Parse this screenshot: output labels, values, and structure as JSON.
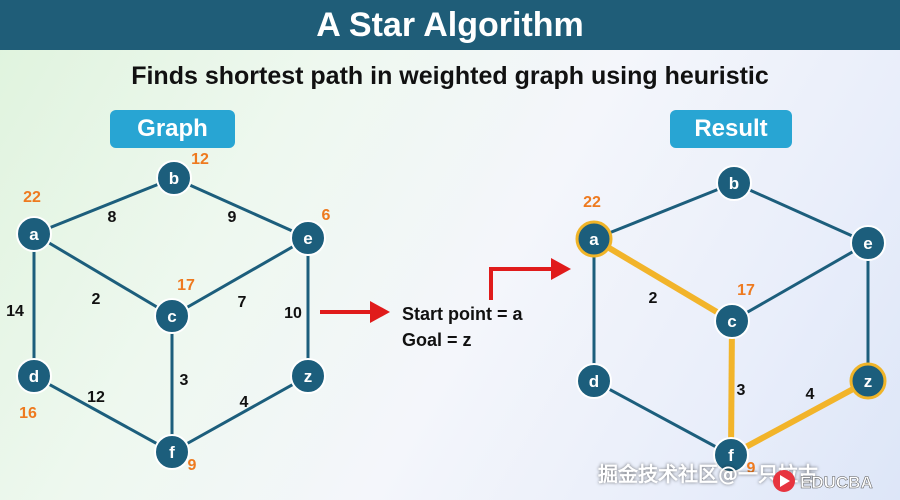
{
  "header": {
    "title": "A Star Algorithm"
  },
  "subtitle": "Finds shortest path in weighted graph using heuristic",
  "labels": {
    "graph": "Graph",
    "result": "Result"
  },
  "info": {
    "start": "Start point = a",
    "goal": "Goal = z"
  },
  "colors": {
    "node": "#1c5e7c",
    "edge": "#1c5e7c",
    "path": "#f2b42a",
    "heuristic": "#ee7a1f",
    "arrow": "#e01b1b",
    "banner": "#1f5d78",
    "pill": "#28a5d3"
  },
  "graph": {
    "nodes": [
      {
        "id": "a",
        "label": "a",
        "heuristic": "22"
      },
      {
        "id": "b",
        "label": "b",
        "heuristic": "12"
      },
      {
        "id": "c",
        "label": "c",
        "heuristic": "17"
      },
      {
        "id": "d",
        "label": "d",
        "heuristic": "16"
      },
      {
        "id": "e",
        "label": "e",
        "heuristic": "6"
      },
      {
        "id": "f",
        "label": "f",
        "heuristic": "9"
      },
      {
        "id": "z",
        "label": "z",
        "heuristic": ""
      }
    ],
    "edges": [
      {
        "from": "a",
        "to": "b",
        "weight": "8"
      },
      {
        "from": "b",
        "to": "e",
        "weight": "9"
      },
      {
        "from": "a",
        "to": "c",
        "weight": "2"
      },
      {
        "from": "c",
        "to": "e",
        "weight": "7"
      },
      {
        "from": "a",
        "to": "d",
        "weight": "14"
      },
      {
        "from": "e",
        "to": "z",
        "weight": "10"
      },
      {
        "from": "c",
        "to": "f",
        "weight": "3"
      },
      {
        "from": "d",
        "to": "f",
        "weight": "12"
      },
      {
        "from": "f",
        "to": "z",
        "weight": "4"
      }
    ]
  },
  "result": {
    "nodes": [
      {
        "id": "a",
        "label": "a",
        "heuristic": "22",
        "highlight": true
      },
      {
        "id": "b",
        "label": "b",
        "heuristic": "",
        "highlight": false
      },
      {
        "id": "c",
        "label": "c",
        "heuristic": "17",
        "highlight": false
      },
      {
        "id": "d",
        "label": "d",
        "heuristic": "",
        "highlight": false
      },
      {
        "id": "e",
        "label": "e",
        "heuristic": "",
        "highlight": false
      },
      {
        "id": "f",
        "label": "f",
        "heuristic": "9",
        "highlight": false
      },
      {
        "id": "z",
        "label": "z",
        "heuristic": "",
        "highlight": true
      }
    ],
    "edges": [
      {
        "from": "a",
        "to": "b",
        "weight": "",
        "path": false
      },
      {
        "from": "b",
        "to": "e",
        "weight": "",
        "path": false
      },
      {
        "from": "a",
        "to": "c",
        "weight": "2",
        "path": true
      },
      {
        "from": "c",
        "to": "e",
        "weight": "",
        "path": false
      },
      {
        "from": "a",
        "to": "d",
        "weight": "",
        "path": false
      },
      {
        "from": "e",
        "to": "z",
        "weight": "",
        "path": false
      },
      {
        "from": "c",
        "to": "f",
        "weight": "3",
        "path": true
      },
      {
        "from": "d",
        "to": "f",
        "weight": "",
        "path": false
      },
      {
        "from": "f",
        "to": "z",
        "weight": "4",
        "path": true
      }
    ]
  },
  "watermark": "掘金技术社区@一只拉古",
  "brand": "EDUCBA"
}
